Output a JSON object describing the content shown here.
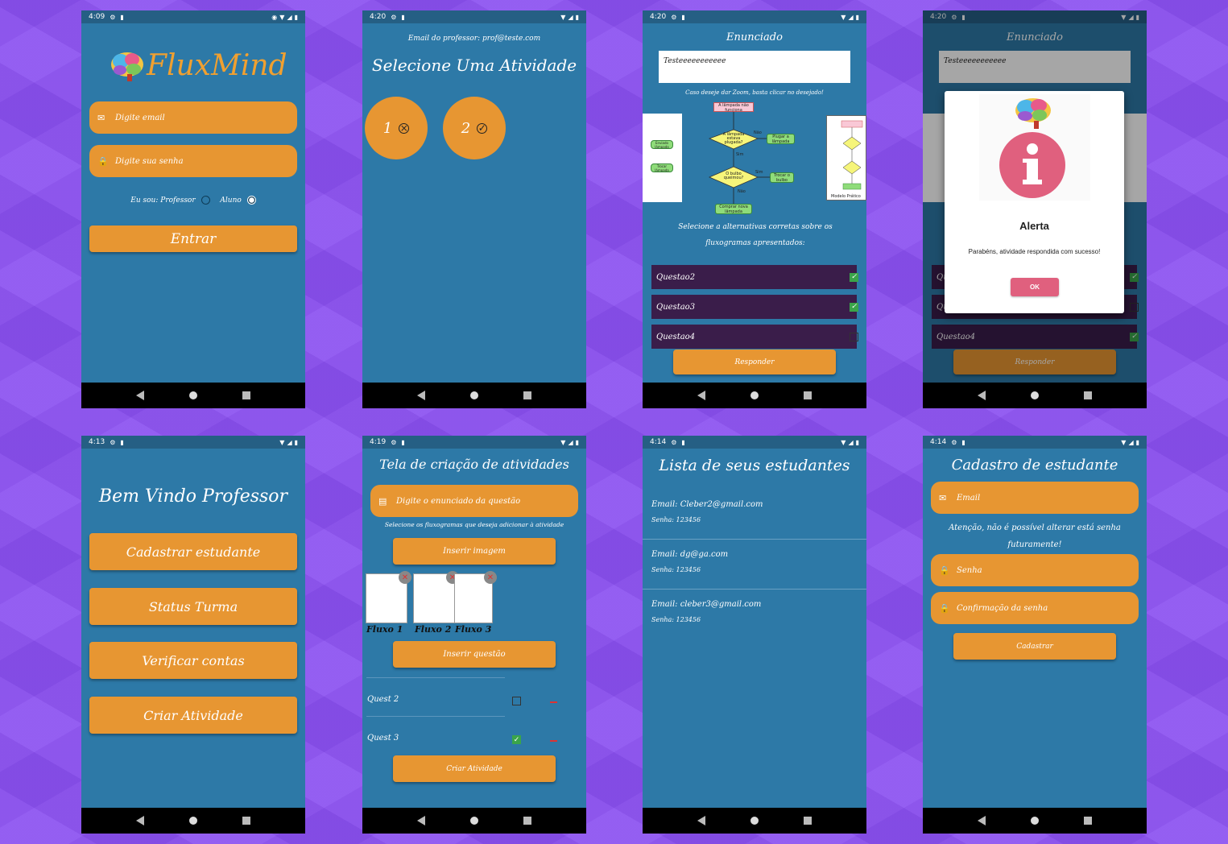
{
  "screens": {
    "login": {
      "time": "4:09",
      "logo": "FluxMind",
      "email_placeholder": "Digite email",
      "password_placeholder": "Digite sua senha",
      "role_label": "Eu sou:",
      "role_professor": "Professor",
      "role_aluno": "Aluno",
      "selected_role": "Aluno",
      "submit_label": "Entrar"
    },
    "select_activity": {
      "time": "4:20",
      "email_line": "Email do professor: prof@teste.com",
      "title": "Selecione Uma Atividade",
      "activities": [
        {
          "label": "1",
          "status": "incomplete",
          "icon": "x-circle-icon"
        },
        {
          "label": "2",
          "status": "complete",
          "icon": "check-circle-icon"
        }
      ]
    },
    "activity": {
      "time": "4:20",
      "header": "Enunciado",
      "statement": "Testeeeeeeeeeee",
      "zoom_hint": "Caso deseje dar Zoom, basta clicar no desejado!",
      "flowchart": {
        "n1": "A lâmpada não funciona",
        "d1": "A lâmpada estava plugada?",
        "d1_no": "Não",
        "d1_yes": "Sim",
        "a1": "Plugar a lâmpada",
        "d2": "O bulbo queimou?",
        "d2_no": "Não",
        "d2_yes": "Sim",
        "a2": "Trocar o bulbo",
        "end": "Comprar nova lâmpada"
      },
      "left_thumb": {
        "a": "Enviado lâmpada",
        "b": "Trocar lâmpada"
      },
      "right_thumb_caption": "Modelo Prático",
      "instructions": "Selecione a alternativas corretas sobre os fluxogramas apresentados:",
      "questions": [
        {
          "label": "Questao2",
          "checked": true
        },
        {
          "label": "Questao3",
          "checked": true
        },
        {
          "label": "Questao4",
          "checked": false
        }
      ],
      "submit_label": "Responder"
    },
    "alert": {
      "time": "4:20",
      "header": "Enunciado",
      "statement": "Testeeeeeeeeeee",
      "modal_title": "Alerta",
      "modal_message": "Parabéns, atividade respondida com sucesso!",
      "modal_ok": "OK",
      "questions": [
        {
          "label": "Qu",
          "checked": true
        },
        {
          "label": "Qu",
          "checked": false
        },
        {
          "label": "Questao4",
          "checked": true
        }
      ],
      "submit_label": "Responder"
    },
    "teacher_home": {
      "time": "4:13",
      "title": "Bem Vindo Professor",
      "buttons": [
        "Cadastrar estudante",
        "Status Turma",
        "Verificar contas",
        "Criar Atividade"
      ]
    },
    "create_activity": {
      "time": "4:19",
      "title": "Tela de criação de atividades",
      "statement_placeholder": "Digite o enunciado da questão",
      "flow_hint": "Selecione os fluxogramas que deseja adicionar à atividade",
      "insert_image_label": "Inserir imagem",
      "thumbs": [
        "Fluxo 1",
        "Fluxo 2",
        "Fluxo 3"
      ],
      "insert_question_label": "Inserir questão",
      "questions": [
        {
          "label": "Quest 2",
          "checked": false
        },
        {
          "label": "Quest 3",
          "checked": true
        }
      ],
      "create_label": "Criar Atividade"
    },
    "students": {
      "time": "4:14",
      "title": "Lista de seus estudantes",
      "items": [
        {
          "email": "Email: Cleber2@gmail.com",
          "senha": "Senha: 123456"
        },
        {
          "email": "Email: dg@ga.com",
          "senha": "Senha: 123456"
        },
        {
          "email": "Email: cleber3@gmail.com",
          "senha": "Senha: 123456"
        }
      ]
    },
    "register_student": {
      "time": "4:14",
      "title": "Cadastro de estudante",
      "email_placeholder": "Email",
      "warning": "Atenção, não é possível alterar está senha futuramente!",
      "password_placeholder": "Senha",
      "confirm_placeholder": "Confirmação da senha",
      "submit_label": "Cadastrar"
    }
  },
  "colors": {
    "background": "#8a4ff0",
    "screen": "#2d79a7",
    "accent": "#e79632",
    "question_row": "#3a1d4a",
    "ok_button": "#e0607e"
  }
}
